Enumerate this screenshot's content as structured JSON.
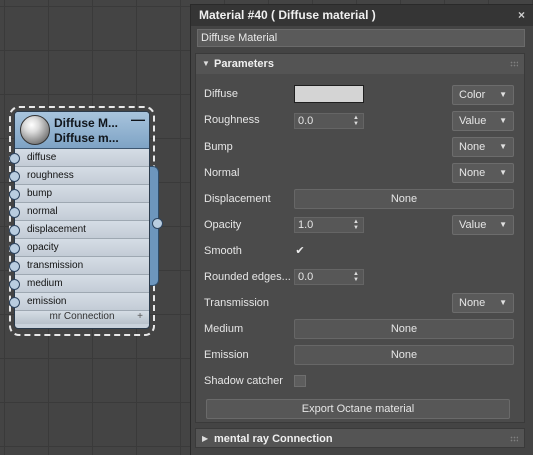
{
  "node": {
    "title_line1": "Diffuse M...",
    "title_line2": "Diffuse m...",
    "minimize_glyph": "—",
    "slots": [
      "diffuse",
      "roughness",
      "bump",
      "normal",
      "displacement",
      "opacity",
      "transmission",
      "medium",
      "emission"
    ],
    "footer": "mr Connection",
    "footer_icon": "+"
  },
  "panel": {
    "title": "Material #40  ( Diffuse material )",
    "close_glyph": "×",
    "name_value": "Diffuse Material",
    "rollout": {
      "title": "Parameters",
      "arrow": "▼"
    },
    "rollout2": {
      "title": "mental ray Connection",
      "arrow": "▶"
    }
  },
  "params": {
    "diffuse_label": "Diffuse",
    "diffuse_color": "#d4d4d4",
    "diffuse_mode": "Color",
    "roughness_label": "Roughness",
    "roughness_value": "0.0",
    "roughness_mode": "Value",
    "bump_label": "Bump",
    "bump_mode": "None",
    "normal_label": "Normal",
    "normal_mode": "None",
    "displacement_label": "Displacement",
    "displacement_button": "None",
    "opacity_label": "Opacity",
    "opacity_value": "1.0",
    "opacity_mode": "Value",
    "smooth_label": "Smooth",
    "smooth_check": "✔",
    "rounded_label": "Rounded edges...",
    "rounded_value": "0.0",
    "transmission_label": "Transmission",
    "transmission_mode": "None",
    "medium_label": "Medium",
    "medium_button": "None",
    "emission_label": "Emission",
    "emission_button": "None",
    "shadow_label": "Shadow catcher",
    "export_button": "Export Octane material"
  },
  "glyphs": {
    "dropdown_arrow": "▼",
    "spin_up": "▲",
    "spin_down": "▼"
  }
}
